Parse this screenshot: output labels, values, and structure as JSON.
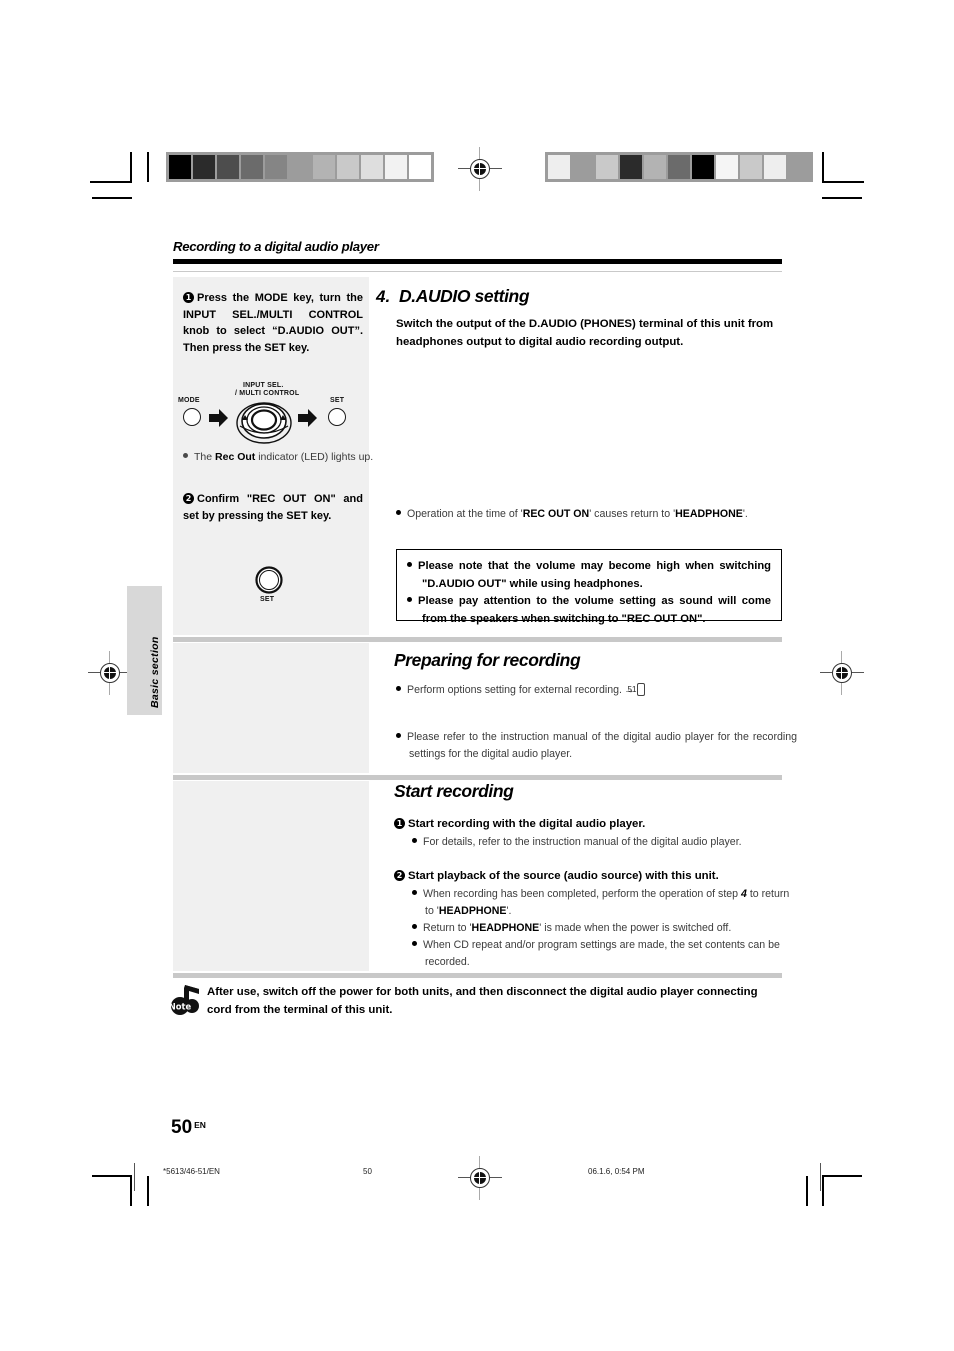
{
  "header": {
    "running_title": "Recording to a digital audio player"
  },
  "left_column": {
    "step1": {
      "number": "1",
      "text": "Press the MODE key, turn the INPUT SEL./MULTI CONTROL knob to select “D.AUDIO OUT”. Then press the SET key."
    },
    "diagram1": {
      "mode_label": "MODE",
      "knob_label_line1": "INPUT SEL.",
      "knob_label_line2": "/ MULTI CONTROL",
      "set_label": "SET"
    },
    "note1": {
      "bullet": "•",
      "text_pre": "The ",
      "text_bold": "Rec Out",
      "text_post": " indicator (LED) lights up."
    },
    "step2": {
      "number": "2",
      "text": "Confirm \"REC OUT ON\" and set by pressing the SET key."
    },
    "diagram2": {
      "set_label": "SET"
    }
  },
  "right_column": {
    "section4": {
      "number": "4.",
      "title": "D.AUDIO setting",
      "description": "Switch the output of the D.AUDIO (PHONES) terminal of this unit from headphones output to digital audio recording output.",
      "operation_note": {
        "pre": "Operation at the time of '",
        "bold1": "REC OUT ON",
        "mid": "' causes return to '",
        "bold2": "HEADPHONE",
        "post": "'."
      },
      "warnings": [
        "Please note that the volume may become high when switching \"D.AUDIO OUT\" while using headphones.",
        "Please pay attention to the volume setting as sound will come from the speakers when switching to \"REC OUT ON\"."
      ]
    },
    "preparing": {
      "title": "Preparing for recording",
      "item1_pre": "Perform options setting for external recording.",
      "item1_arrow": "→",
      "item1_pageref": "51",
      "item2": "Please refer to the instruction manual of the digital audio player for the recording settings for the digital audio player."
    },
    "start_recording": {
      "title": "Start recording",
      "step1": {
        "number": "1",
        "text": "Start recording with the digital audio player.",
        "sub": "For details, refer to the instruction manual of the digital audio player."
      },
      "step2": {
        "number": "2",
        "text": "Start playback of the source (audio source) with this unit.",
        "subs": [
          {
            "pre": "When recording has been completed, perform the operation of step ",
            "italic_bold": "4",
            "mid": " to return to '",
            "bold": "HEADPHONE",
            "post": "'."
          },
          {
            "pre": "Return to '",
            "bold": "HEADPHONE",
            "post": "' is made when the power is switched off."
          },
          {
            "pre": "When CD repeat and/or program settings are made, the set contents can be recorded.",
            "bold": "",
            "post": ""
          }
        ]
      }
    }
  },
  "note_block": {
    "icon_label": "Note",
    "text": "After use, switch off the power for both units, and then disconnect the digital audio player connecting cord from the terminal of this unit."
  },
  "side_tab": {
    "label": "Basic section"
  },
  "page_number": {
    "number": "50",
    "suffix": "EN"
  },
  "footer": {
    "left": "*5613/46-51/EN",
    "center": "50",
    "right": "06.1.6, 0:54 PM"
  },
  "calibration": {
    "left_strip": [
      "#000000",
      "#2b2b2b",
      "#4d4d4d",
      "#6b6b6b",
      "#858585",
      "#9c9c9c",
      "#b3b3b3",
      "#c9c9c9",
      "#dedede",
      "#f2f2f2",
      "#ffffff"
    ],
    "right_strip": [
      "#eeeeee",
      "#9c9c9c",
      "#c9c9c9",
      "#2b2b2b",
      "#b3b3b3",
      "#6b6b6b",
      "#000000",
      "#f5f5f5",
      "#c9c9c9",
      "#eeeeee",
      "#9c9c9c"
    ]
  }
}
